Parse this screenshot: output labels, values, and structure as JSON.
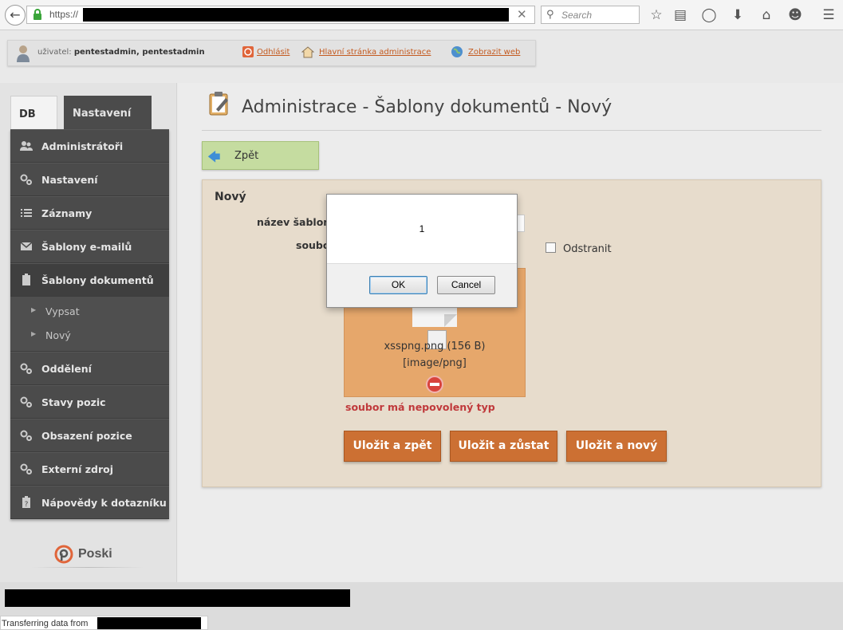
{
  "browser": {
    "url_prefix": "https://",
    "search_placeholder": "Search"
  },
  "userbar": {
    "user_label": "uživatel:",
    "user_name": "pentestadmin, pentestadmin",
    "logout": "Odhlásit",
    "admin_home": "Hlavní stránka administrace",
    "view_web": "Zobrazit web"
  },
  "tabs": [
    "DB",
    "Nastavení"
  ],
  "sidebar": {
    "items": [
      {
        "label": "Administrátoři",
        "icon": "users-icon"
      },
      {
        "label": "Nastavení",
        "icon": "gears-icon"
      },
      {
        "label": "Záznamy",
        "icon": "list-icon"
      },
      {
        "label": "Šablony e-mailů",
        "icon": "mail-icon"
      },
      {
        "label": "Šablony dokumentů",
        "icon": "clipboard-icon"
      }
    ],
    "sub_items": [
      "Vypsat",
      "Nový"
    ],
    "items_after": [
      {
        "label": "Oddělení",
        "icon": "gears-icon"
      },
      {
        "label": "Stavy pozic",
        "icon": "gears-icon"
      },
      {
        "label": "Obsazení pozice",
        "icon": "gears-icon"
      },
      {
        "label": "Externí zdroj",
        "icon": "gears-icon"
      },
      {
        "label": "Nápovědy k dotazníku",
        "icon": "help-clipboard-icon"
      }
    ],
    "logo": "Poski"
  },
  "main": {
    "title": "Administrace - Šablony dokumentů - Nový",
    "back": "Zpět",
    "panel_title": "Nový",
    "name_label": "název šablony",
    "file_label": "soubor",
    "remove_label": "Odstranit",
    "file_name": "xsspng.png",
    "file_size": "(156 B)",
    "file_type": "[image/png]",
    "error": "soubor má nepovolený typ",
    "buttons": [
      "Uložit a zpět",
      "Uložit a zůstat",
      "Uložit a nový"
    ]
  },
  "status": {
    "text": "Transferring data from"
  },
  "dialog": {
    "message": "1",
    "ok": "OK",
    "cancel": "Cancel"
  },
  "colors": {
    "accent": "#cc7033",
    "back_button": "#c5dca0",
    "sidebar": "#4b4b4b",
    "error": "#c0393b"
  }
}
